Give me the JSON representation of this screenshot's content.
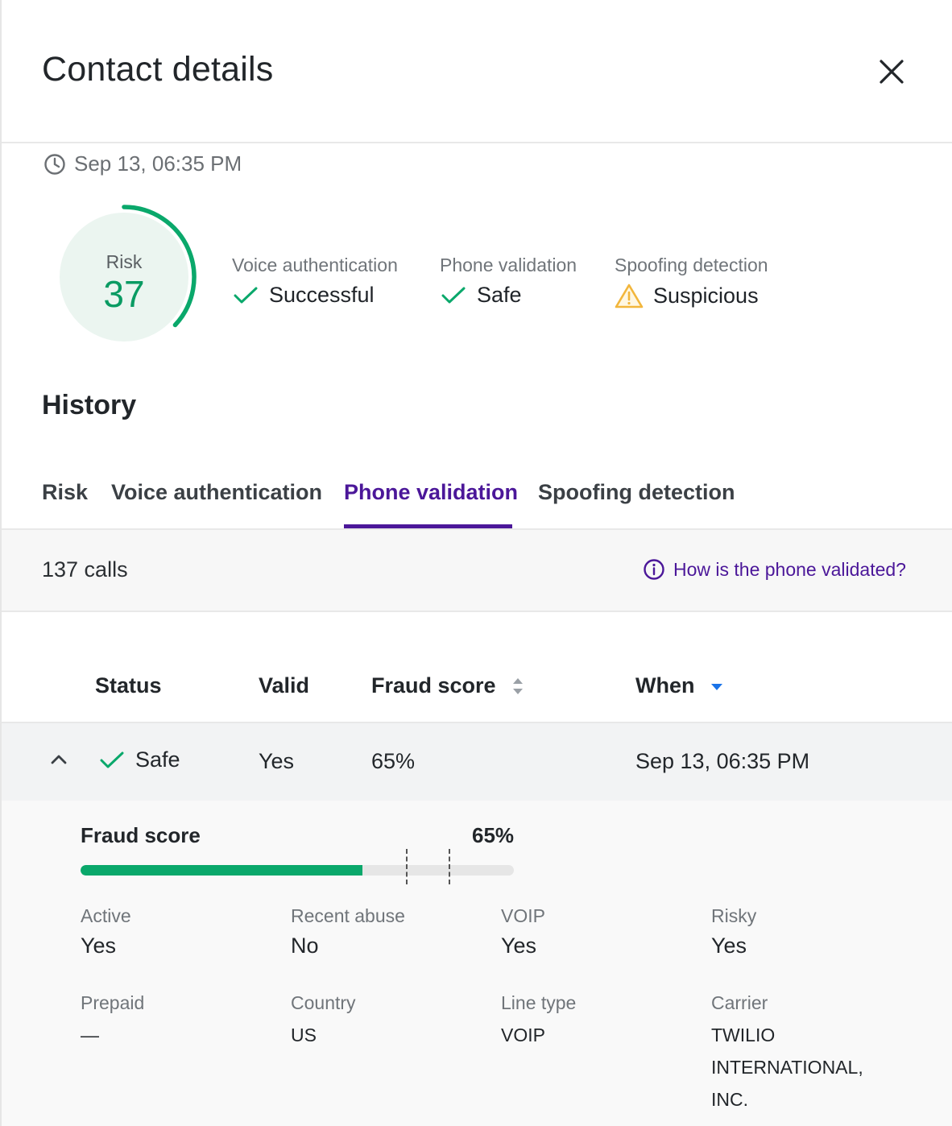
{
  "header": {
    "title": "Contact details"
  },
  "summary": {
    "timestamp": "Sep 13, 06:35 PM",
    "risk": {
      "label": "Risk",
      "value": "37",
      "score": 37,
      "max": 100,
      "color": "#0a9b63"
    },
    "metrics": [
      {
        "label": "Voice authentication",
        "value": "Successful",
        "status": "check-icon"
      },
      {
        "label": "Phone validation",
        "value": "Safe",
        "status": "check-icon"
      },
      {
        "label": "Spoofing detection",
        "value": "Suspicious",
        "status": "warning-icon"
      }
    ]
  },
  "history": {
    "title": "History",
    "tabs": [
      {
        "label": "Risk"
      },
      {
        "label": "Voice authentication"
      },
      {
        "label": "Phone validation",
        "active": true
      },
      {
        "label": "Spoofing detection"
      }
    ],
    "calls_count": "137 calls",
    "help_link": "How is the phone validated?",
    "columns": {
      "status": "Status",
      "valid": "Valid",
      "fraud_score": "Fraud score",
      "when": "When"
    },
    "rows": [
      {
        "status": "Safe",
        "valid": "Yes",
        "fraud_score": "65%",
        "when": "Sep 13, 06:35 PM"
      }
    ],
    "detail": {
      "fraud_score_label": "Fraud score",
      "fraud_score_value": "65%",
      "fraud_score_fill_fraction": 0.65,
      "properties": [
        {
          "label": "Active",
          "value": "Yes"
        },
        {
          "label": "Recent abuse",
          "value": "No"
        },
        {
          "label": "VOIP",
          "value": "Yes"
        },
        {
          "label": "Risky",
          "value": "Yes"
        },
        {
          "label": "Prepaid",
          "value": "—"
        },
        {
          "label": "Country",
          "value": "US"
        },
        {
          "label": "Line type",
          "value": "VOIP"
        },
        {
          "label": "Carrier",
          "value": "TWILIO INTERNATIONAL, INC."
        }
      ]
    }
  },
  "colors": {
    "accent": "#4b1799",
    "success": "#0aa86b",
    "warning": "#f2b63c"
  }
}
